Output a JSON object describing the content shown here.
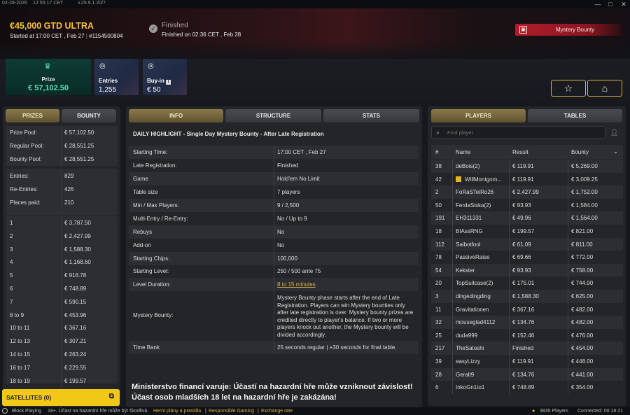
{
  "titlebar": {
    "date": "02-28-2026",
    "time": "12:55:17 CET",
    "version": "v.25.9.1.20/7",
    "minimize": "—",
    "maximize": "□",
    "close": "✕"
  },
  "header": {
    "title": "€45,000 GTD ULTRA",
    "started": "Started at 17:00 CET , Feb 27",
    "separator": "|",
    "tournament_id": "#1154500804",
    "status": "Finished",
    "finished_on": "Finished on 02:36 CET , Feb 28",
    "mystery_button": "Mystery Bounty",
    "colors": {
      "accent": "#f2c23a",
      "prize": "#59e0b4",
      "mystery": "#b01e2a"
    }
  },
  "stats": {
    "prize_label": "Prize",
    "prize_value": "€ 57,102.50",
    "entries_label": "Entries",
    "entries_value": "1,255",
    "buyin_label": "Buy-in",
    "buyin_value": "€ 50",
    "icons": [
      "trophy-icon",
      "chip-icon",
      "chip-icon",
      "info-icon",
      "star-icon",
      "lobby-icon"
    ]
  },
  "left": {
    "tabs": [
      "PRIZES",
      "BOUNTY"
    ],
    "pool": [
      {
        "k": "Prize Pool:",
        "v": "€ 57,102.50"
      },
      {
        "k": "Regular Pool:",
        "v": "€ 28,551.25"
      },
      {
        "k": "Bounty Pool:",
        "v": "€ 28,551.25"
      }
    ],
    "entries": [
      {
        "k": "Entries:",
        "v": "829"
      },
      {
        "k": "Re-Entries:",
        "v": "426"
      },
      {
        "k": "Places paid:",
        "v": "210"
      }
    ],
    "places": [
      {
        "k": "1",
        "v": "€ 3,787.50"
      },
      {
        "k": "2",
        "v": "€ 2,427.99"
      },
      {
        "k": "3",
        "v": "€ 1,588.30"
      },
      {
        "k": "4",
        "v": "€ 1,168.60"
      },
      {
        "k": "5",
        "v": "€ 916.78"
      },
      {
        "k": "6",
        "v": "€ 748.89"
      },
      {
        "k": "7",
        "v": "€ 590.15"
      },
      {
        "k": "8  to  9",
        "v": "€ 453.96"
      },
      {
        "k": "10  to  11",
        "v": "€ 367.16"
      },
      {
        "k": "12  to  13",
        "v": "€ 307.21"
      },
      {
        "k": "14  to  15",
        "v": "€ 263.24"
      },
      {
        "k": "16  to  17",
        "v": "€ 229.55"
      },
      {
        "k": "18  to  19",
        "v": "€ 199.57"
      }
    ],
    "satellites": "SATELLITES (0)"
  },
  "info": {
    "tabs": [
      "INFO",
      "STRUCTURE",
      "STATS"
    ],
    "highlight": "DAILY HIGHLIGHT - Single Day Mystery Bounty - After Late Registration",
    "rows": [
      {
        "k": "Starting Time:",
        "v": "17:00 CET , Feb 27"
      },
      {
        "k": "Late Registration:",
        "v": "Finished"
      },
      {
        "k": "Game",
        "v": "Hold'em No Limit"
      },
      {
        "k": "Table size",
        "v": "7 players"
      },
      {
        "k": "Min / Max Players:",
        "v": "9 / 2,500"
      },
      {
        "k": "Multi-Entry / Re-Entry:",
        "v": "No / Up to 9"
      },
      {
        "k": "Rebuys",
        "v": "No"
      },
      {
        "k": "Add-on",
        "v": "No"
      },
      {
        "k": "Starting Chips:",
        "v": "100,000"
      },
      {
        "k": "Starting Level:",
        "v": "250 / 500 ante 75"
      },
      {
        "k": "Level Duration:",
        "v": "8 to 15 minutes"
      },
      {
        "k": "Mystery Bounty:",
        "v": "Mystery Bounty phase starts after the end of Late Registration. Players can win Mystery bounties only after late registration is over. Mystery bounty prizes are credited directly to player's balance. If two or more players knock out another, the Mystery bounty will be divided accordingly."
      },
      {
        "k": "Time Bank",
        "v": "25 seconds regular | +30 seconds for final table."
      }
    ],
    "warning_line1": "Ministerstvo financí varuje: Účastí na hazardní hře může vzniknout závislost!",
    "warning_line2": "Účast osob mladších 18 let na hazardní hře je zakázána!"
  },
  "players": {
    "tabs": [
      "PLAYERS",
      "TABLES"
    ],
    "search_placeholder": "Find player",
    "columns": [
      "#",
      "Name",
      "Result",
      "Bounty"
    ],
    "rows": [
      {
        "rank": "38",
        "name": "deBois(2)",
        "result": "€ 119.91",
        "bounty": "€ 5,269.00"
      },
      {
        "rank": "42",
        "name": "WillMontgom...",
        "result": "€ 119.91",
        "bounty": "€ 3,009.25",
        "flag": "#e4b323"
      },
      {
        "rank": "2",
        "name": "FoRaSTeiRo26",
        "result": "€ 2,427.99",
        "bounty": "€ 1,752.00"
      },
      {
        "rank": "50",
        "name": "FerdaSiska(2)",
        "result": "€ 93.93",
        "bounty": "€ 1,584.00"
      },
      {
        "rank": "191",
        "name": "EH311331",
        "result": "€ 49.96",
        "bounty": "€ 1,564.00"
      },
      {
        "rank": "18",
        "name": "BIAssRNG",
        "result": "€ 199.57",
        "bounty": "€ 821.00"
      },
      {
        "rank": "112",
        "name": "Saibotfool",
        "result": "€ 61.09",
        "bounty": "€ 811.00"
      },
      {
        "rank": "78",
        "name": "PassiveRaise",
        "result": "€ 69.66",
        "bounty": "€ 772.00"
      },
      {
        "rank": "54",
        "name": "Kekster",
        "result": "€ 93.93",
        "bounty": "€ 758.00"
      },
      {
        "rank": "20",
        "name": "TopSuitcase(2)",
        "result": "€ 175.01",
        "bounty": "€ 744.00"
      },
      {
        "rank": "3",
        "name": "dingedingding",
        "result": "€ 1,588.30",
        "bounty": "€ 625.00"
      },
      {
        "rank": "11",
        "name": "Gravitationen",
        "result": "€ 367.16",
        "bounty": "€ 482.00"
      },
      {
        "rank": "32",
        "name": "mouseglad4112",
        "result": "€ 134.76",
        "bounty": "€ 482.00"
      },
      {
        "rank": "25",
        "name": "duda999",
        "result": "€ 152.46",
        "bounty": "€ 476.00"
      },
      {
        "rank": "217",
        "name": "TheSatoshi",
        "result": "Finished",
        "bounty": "€ 454.00"
      },
      {
        "rank": "39",
        "name": "easyLizzy",
        "result": "€ 119.91",
        "bounty": "€ 448.00"
      },
      {
        "rank": "28",
        "name": "Geralt9",
        "result": "€ 134.76",
        "bounty": "€ 441.00"
      },
      {
        "rank": "6",
        "name": "InkoGn1to1",
        "result": "€ 748.89",
        "bounty": "€ 354.00"
      }
    ]
  },
  "footer": {
    "block": "Block Playing",
    "legal": "18+. Účast na hazardní hře může být škodlivá.",
    "links": "Herní plány a pravidla",
    "sep": "|",
    "responsible": "Responsible Gaming",
    "exchange": "Exchange rate",
    "players_count": "3835 Players",
    "connected": "Connected: 00:18:21"
  }
}
